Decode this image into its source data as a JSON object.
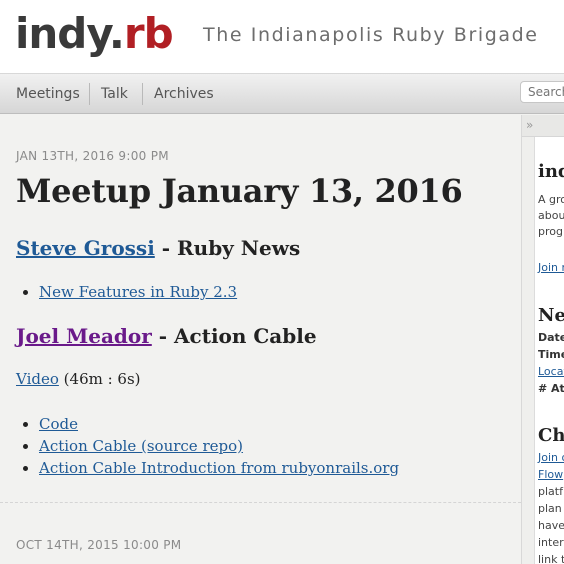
{
  "site": {
    "logo_main": "indy",
    "logo_dot": ".",
    "logo_ext": "rb",
    "tagline": "The Indianapolis Ruby Brigade"
  },
  "nav": {
    "items": [
      "Meetings",
      "Talk",
      "Archives"
    ],
    "search_placeholder": "Search"
  },
  "posts": [
    {
      "date": "JAN 13TH, 2016 9:00 PM",
      "title": "Meetup January 13, 2016",
      "talks": [
        {
          "speaker": "Steve Grossi",
          "topic": "- Ruby News",
          "links": [
            "New Features in Ruby 2.3"
          ]
        },
        {
          "speaker": "Joel Meador",
          "topic": "- Action Cable",
          "video_label": "Video",
          "video_duration": "(46m : 6s)",
          "links": [
            "Code",
            "Action Cable (source repo)",
            "Action Cable Introduction from rubyonrails.org"
          ]
        }
      ]
    },
    {
      "date": "OCT 14TH, 2015 10:00 PM"
    }
  ],
  "sidebar": {
    "toggle": "»",
    "about_heading": "ind",
    "about_lines": [
      "A gro",
      "abou",
      "progr"
    ],
    "join_link": "Join n",
    "next_heading": "Nex",
    "next_labels": [
      "Dates",
      "Time",
      "Locat",
      "# Att"
    ],
    "chat_heading": "Cha",
    "chat_lines": [
      "Join o",
      "Flow",
      "platf",
      "plan",
      "have",
      "inter",
      "link t"
    ]
  },
  "colors": {
    "accent": "#b11f24",
    "link": "#1f5a96",
    "visited_link": "#6a1a8a"
  }
}
